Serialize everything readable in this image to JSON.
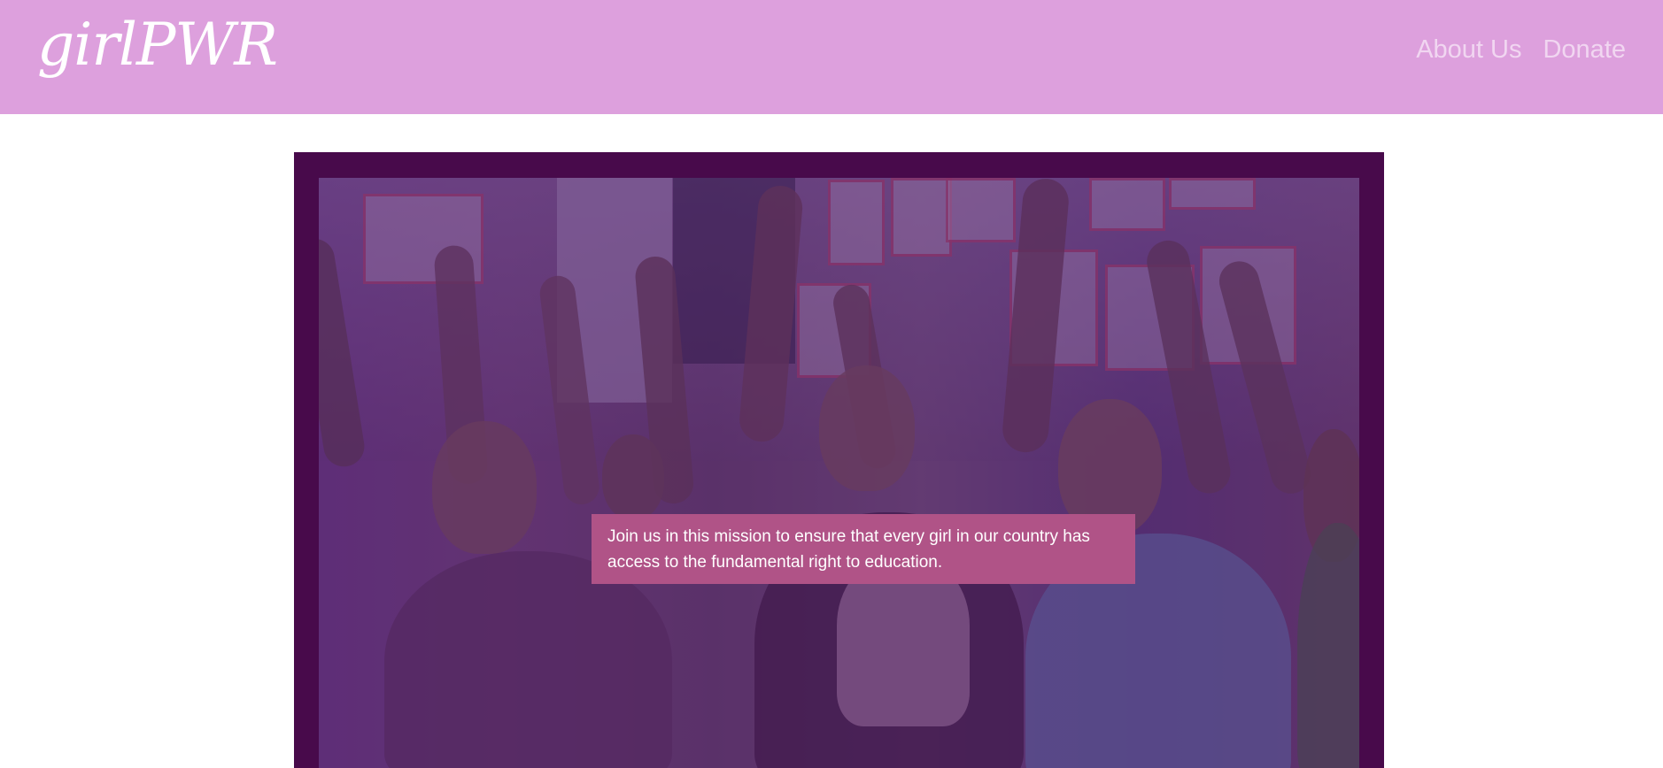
{
  "nav": {
    "brand": "girlPWR",
    "links": [
      {
        "label": "About Us"
      },
      {
        "label": "Donate"
      }
    ]
  },
  "hero": {
    "message": "Join us in this mission to ensure that every girl in our country has access to the fundamental right to education."
  },
  "colors": {
    "header_background": "#dda0dd",
    "hero_frame": "#480a4b",
    "message_background": "#b05387",
    "text_light": "#ffffff"
  }
}
